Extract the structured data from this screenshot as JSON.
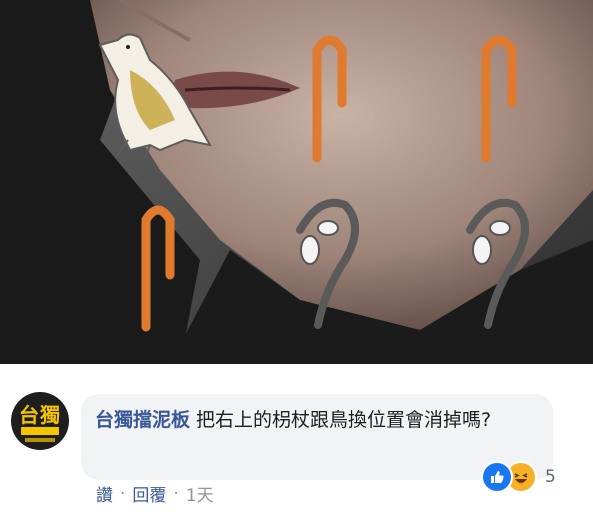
{
  "image": {
    "description_icon": "meme-photo-with-hieroglyph-overlays"
  },
  "comment": {
    "avatar_text": "台獨",
    "author": "台獨擋泥板",
    "text": "把右上的枴杖跟鳥換位置會消掉嗎?",
    "reaction_count": "5",
    "reaction_icons": [
      "like-icon",
      "haha-icon"
    ]
  },
  "actions": {
    "like": "讚",
    "separator": "·",
    "reply": "回覆",
    "time": "1天"
  },
  "colors": {
    "author": "#385898",
    "bubble": "#f2f3f5",
    "like_blue": "#1877f2",
    "haha_yellow": "#f7b125",
    "cane_orange": "#e07a2e"
  }
}
